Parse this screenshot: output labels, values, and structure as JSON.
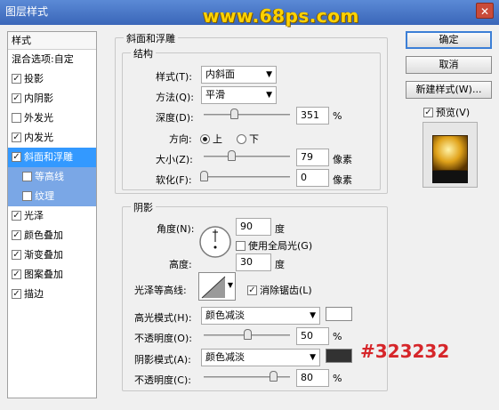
{
  "window": {
    "title": "图层样式",
    "close_glyph": "✕"
  },
  "watermark": "www.68ps.com",
  "sidebar": {
    "header": "样式",
    "blend_options": "混合选项:自定",
    "items": [
      {
        "label": "投影",
        "checked": true
      },
      {
        "label": "内阴影",
        "checked": true
      },
      {
        "label": "外发光",
        "checked": false
      },
      {
        "label": "内发光",
        "checked": true
      },
      {
        "label": "斜面和浮雕",
        "checked": true,
        "selected": true
      },
      {
        "label": "等高线",
        "checked": false,
        "sub": true
      },
      {
        "label": "纹理",
        "checked": false,
        "sub": true
      },
      {
        "label": "光泽",
        "checked": true
      },
      {
        "label": "颜色叠加",
        "checked": true
      },
      {
        "label": "渐变叠加",
        "checked": true
      },
      {
        "label": "图案叠加",
        "checked": true
      },
      {
        "label": "描边",
        "checked": true
      }
    ]
  },
  "bevel": {
    "group_title": "斜面和浮雕",
    "structure_title": "结构",
    "style_label": "样式(T):",
    "style_value": "内斜面",
    "method_label": "方法(Q):",
    "method_value": "平滑",
    "depth_label": "深度(D):",
    "depth_value": "351",
    "depth_unit": "%",
    "depth_fraction": 0.35,
    "direction_label": "方向:",
    "direction_up": "上",
    "direction_down": "下",
    "size_label": "大小(Z):",
    "size_value": "79",
    "size_unit": "像素",
    "size_fraction": 0.32,
    "soften_label": "软化(F):",
    "soften_value": "0",
    "soften_unit": "像素",
    "soften_fraction": 0.0
  },
  "shading": {
    "title": "阴影",
    "angle_label": "角度(N):",
    "angle_value": "90",
    "angle_unit": "度",
    "global_light_label": "使用全局光(G)",
    "altitude_label": "高度:",
    "altitude_value": "30",
    "altitude_unit": "度",
    "gloss_contour_label": "光泽等高线:",
    "anti_alias_label": "消除锯齿(L)",
    "highlight_mode_label": "高光模式(H):",
    "highlight_mode_value": "颜色减淡",
    "highlight_color": "#ffffff",
    "highlight_opacity_label": "不透明度(O):",
    "highlight_opacity_value": "50",
    "highlight_opacity_unit": "%",
    "highlight_opacity_fraction": 0.5,
    "shadow_mode_label": "阴影模式(A):",
    "shadow_mode_value": "颜色减淡",
    "shadow_color": "#323232",
    "shadow_color_annotation": "#323232",
    "shadow_opacity_label": "不透明度(C):",
    "shadow_opacity_value": "80",
    "shadow_opacity_unit": "%",
    "shadow_opacity_fraction": 0.8
  },
  "buttons": {
    "ok": "确定",
    "cancel": "取消",
    "new_style": "新建样式(W)...",
    "preview": "预览(V)"
  },
  "icons": {
    "dropdown": "▼",
    "check": "✓"
  }
}
